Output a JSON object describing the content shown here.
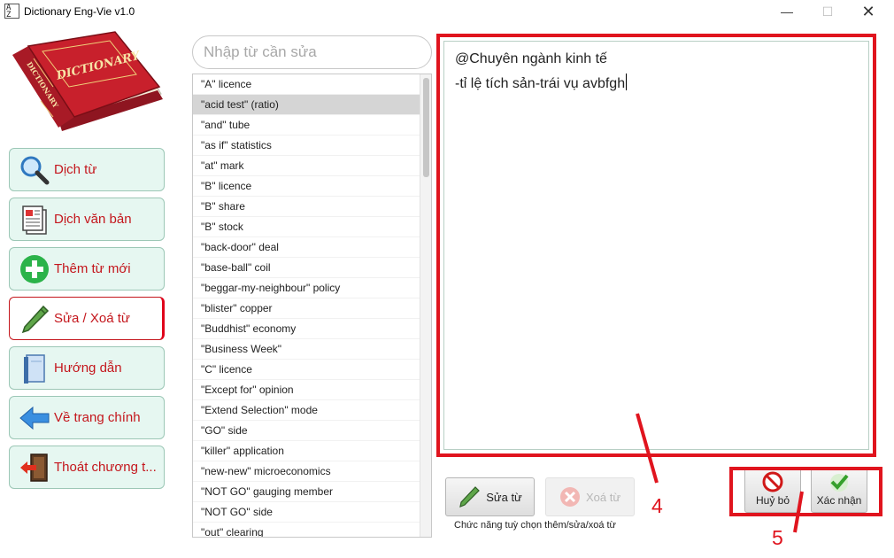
{
  "window": {
    "title": "Dictionary Eng-Vie v1.0",
    "icon_text": "A\nZ",
    "minimize_glyph": "—",
    "maximize_glyph": "☐",
    "close_glyph": "✕"
  },
  "logo": {
    "front_text": "DICTIONARY",
    "spine_text": "DICTIONARY",
    "cover_color": "#c8202c"
  },
  "sidebar": {
    "items": [
      {
        "label": "Dịch từ",
        "icon": "magnifier-icon",
        "active": false
      },
      {
        "label": "Dịch văn bản",
        "icon": "document-icon",
        "active": false
      },
      {
        "label": "Thêm từ mới",
        "icon": "plus-icon",
        "active": false
      },
      {
        "label": "Sửa / Xoá từ",
        "icon": "pen-icon",
        "active": true
      },
      {
        "label": "Hướng dẫn",
        "icon": "book-icon",
        "active": false
      },
      {
        "label": "Về trang chính",
        "icon": "arrow-left-icon",
        "active": false
      },
      {
        "label": "Thoát chương t...",
        "icon": "exit-door-icon",
        "active": false
      }
    ]
  },
  "search": {
    "placeholder": "Nhập từ cần sửa",
    "value": ""
  },
  "word_list": {
    "selected_index": 1,
    "items": [
      "\"A\" licence",
      "\"acid test\" (ratio)",
      "\"and\" tube",
      "\"as if\" statistics",
      "\"at\" mark",
      "\"B\" licence",
      "\"B\" share",
      "\"B\" stock",
      "\"back-door\" deal",
      "\"base-ball\" coil",
      "\"beggar-my-neighbour\" policy",
      "\"blister\" copper",
      "\"Buddhist\" economy",
      "\"Business Week\"",
      "\"C\" licence",
      "\"Except for\" opinion",
      "\"Extend Selection\" mode",
      "\"GO\" side",
      "\"killer\" application",
      "\"new-new\" microeconomics",
      "\"NOT GO\" gauging member",
      "\"NOT GO\" side",
      "\"out\" clearing"
    ]
  },
  "editor": {
    "line1": "@Chuyên ngành kinh tế",
    "line2": "-tỉ lệ tích sản-trái vụ avbfgh"
  },
  "actions": {
    "edit_label": "Sửa từ",
    "delete_label": "Xoá từ",
    "caption": "Chức năng tuỳ chọn thêm/sửa/xoá từ",
    "cancel_label": "Huỷ bỏ",
    "confirm_label": "Xác nhận"
  },
  "annotations": {
    "label_4": "4",
    "label_5": "5",
    "color": "#e0141e"
  },
  "colors": {
    "nav_bg": "#e6f7f1",
    "nav_text": "#c4161c",
    "selection_bg": "#d5d5d5"
  }
}
